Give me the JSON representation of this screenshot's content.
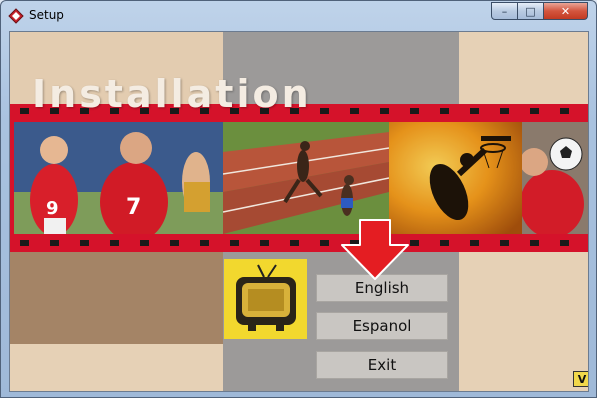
{
  "window": {
    "title": "Setup",
    "controls": {
      "minimize": "–",
      "maximize": "□",
      "close": "✕"
    }
  },
  "banner": {
    "heading": "Installation",
    "photos": [
      "soccer-players",
      "sprinters-on-track",
      "basketball-dunk-silhouette",
      "soccer-player-with-ball"
    ]
  },
  "menu": {
    "buttons": [
      {
        "label": "English"
      },
      {
        "label": "Espanol"
      },
      {
        "label": "Exit"
      }
    ]
  },
  "icons": {
    "app": "setup-diamond-icon",
    "pointer": "red-down-arrow",
    "tv": "yellow-tv-icon",
    "corner_badge": "v-logo-icon"
  },
  "corner_badge": {
    "text": "V"
  },
  "colors": {
    "film_red": "#d5122a",
    "gray_column": "#9c9a99",
    "beige": "#e6d1b6",
    "brown_panel": "#a48466",
    "button_face": "#c9c6c2",
    "arrow_red": "#e41d22"
  }
}
